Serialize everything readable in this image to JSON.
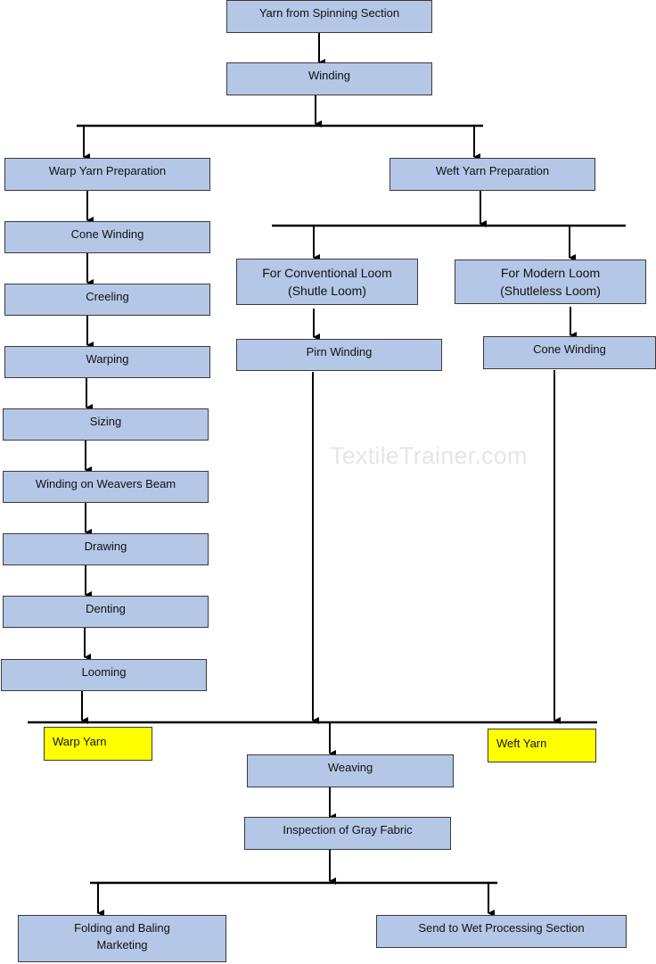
{
  "title_node": "Yarn from Spinning Section",
  "winding": "Winding",
  "warp": {
    "header": "Warp Yarn Preparation",
    "steps": [
      "Cone Winding",
      "Creeling",
      "Warping",
      "Sizing",
      "Winding on Weavers Beam",
      "Drawing",
      "Denting",
      "Looming"
    ],
    "output_label": "Warp Yarn"
  },
  "weft": {
    "header": "Weft Yarn Preparation",
    "conventional": {
      "label": "For Conventional Loom\n(Shutle Loom)",
      "step": "Pirn Winding"
    },
    "modern": {
      "label": "For Modern Loom\n(Shutleless Loom)",
      "step": "Cone Winding"
    },
    "output_label": "Weft Yarn"
  },
  "weaving": "Weaving",
  "inspection": "Inspection of Gray Fabric",
  "outputs": {
    "folding": "Folding and Baling\nMarketing",
    "wet_processing": "Send to Wet Processing Section"
  },
  "watermark": "TextileTrainer.com",
  "colors": {
    "node_fill": "#b4c7e7",
    "highlight_fill": "#ffff00",
    "line": "#000000"
  }
}
